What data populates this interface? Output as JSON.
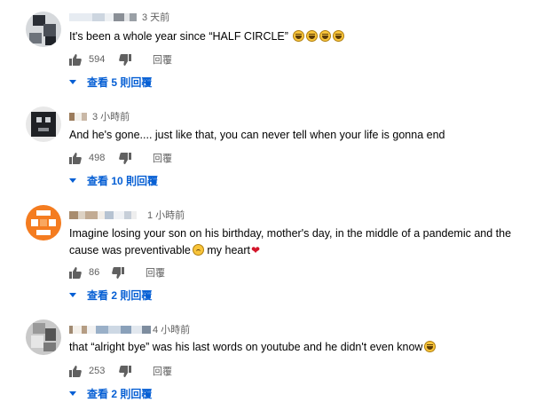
{
  "comments": [
    {
      "time": "3 天前",
      "text_parts": [
        "It's been a whole year since “HALF CIRCLE”"
      ],
      "emojis": [
        "face-with-tears-of-joy-icon",
        "face-with-tears-of-joy-icon",
        "face-with-tears-of-joy-icon",
        "face-with-tears-of-joy-icon"
      ],
      "likes": "594",
      "reply_label": "回覆",
      "view_replies": "查看 5 則回覆"
    },
    {
      "time": "3 小時前",
      "text_parts": [
        "And he's gone.... just like that, you can never tell when your life is gonna end"
      ],
      "likes": "498",
      "reply_label": "回覆",
      "view_replies": "查看 10 則回覆"
    },
    {
      "time": "1 小時前",
      "text_parts": [
        "Imagine losing your son on his birthday, mother's day, in the middle of a pandemic and the cause was preventivable",
        " my heart"
      ],
      "emojis": [
        "disappointed-face-icon",
        "red-heart-icon"
      ],
      "likes": "86",
      "reply_label": "回覆",
      "view_replies": "查看 2 則回覆"
    },
    {
      "time": "4 小時前",
      "text_parts": [
        "that “alright bye” was his last words on youtube and he didn't even know"
      ],
      "emojis": [
        "weary-face-icon"
      ],
      "likes": "253",
      "reply_label": "回覆",
      "view_replies": "查看 2 則回覆"
    }
  ],
  "colors": {
    "link": "#065fd4",
    "meta": "#606060",
    "avatar_orange": "#f47c20"
  }
}
